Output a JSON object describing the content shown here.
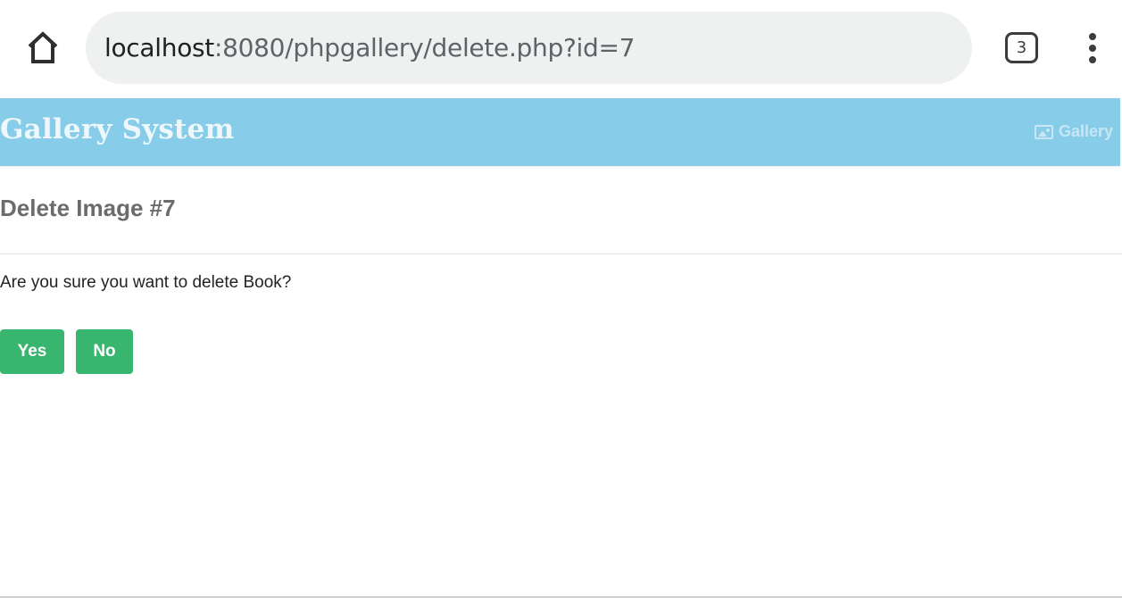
{
  "browser": {
    "url_host": "localhost",
    "url_path": ":8080/phpgallery/delete.php?id=7",
    "tab_count": "3",
    "icons": {
      "home": "home-icon",
      "tabs": "tab-switcher-icon",
      "menu": "more-vert-icon"
    }
  },
  "navbar": {
    "brand": "Gallery System",
    "link_label": "Gallery",
    "link_icon": "image-icon",
    "background": "#87cce9"
  },
  "main": {
    "title": "Delete Image #7",
    "message": "Are you sure you want to delete Book?",
    "yes_label": "Yes",
    "no_label": "No",
    "button_color": "#38b56e"
  }
}
